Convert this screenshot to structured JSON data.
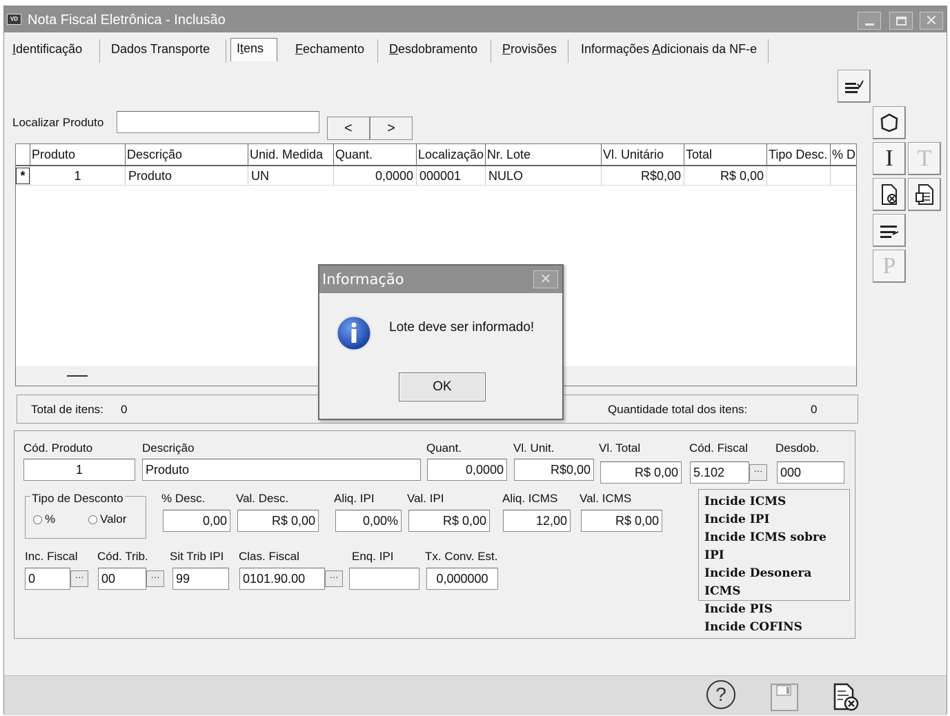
{
  "window": {
    "app_icon": "VD",
    "title": "Nota Fiscal Eletrônica - Inclusão"
  },
  "tabs": [
    {
      "pre": "",
      "u": "I",
      "post": "dentificação"
    },
    {
      "pre": "Dados Transporte",
      "u": "",
      "post": ""
    },
    {
      "pre": "I",
      "u": "t",
      "post": "ens"
    },
    {
      "pre": "",
      "u": "F",
      "post": "echamento"
    },
    {
      "pre": "",
      "u": "D",
      "post": "esdobramento"
    },
    {
      "pre": "",
      "u": "P",
      "post": "rovisões"
    },
    {
      "pre": "Informações ",
      "u": "A",
      "post": "dicionais da NF-e"
    }
  ],
  "search": {
    "label": "Localizar Produto",
    "value": "",
    "prev": "<",
    "next": ">"
  },
  "side_tools": {
    "i": "I",
    "t": "T",
    "p": "P"
  },
  "grid": {
    "headers": [
      "Produto",
      "Descrição",
      "Unid. Medida",
      "Quant.",
      "Localização",
      "Nr. Lote",
      "Vl. Unitário",
      "Total",
      "Tipo Desc.",
      "% D"
    ],
    "row": {
      "marker": "*",
      "cells": [
        "1",
        "Produto",
        "UN",
        "0,0000",
        "000001",
        "NULO",
        "R$0,00",
        "R$ 0,00",
        "",
        ""
      ]
    }
  },
  "totals": {
    "items_label": "Total de itens:",
    "items_value": "0",
    "qty_label": "Quantidade total dos itens:",
    "qty_value": "0"
  },
  "detail": {
    "cod_produto": {
      "label": "Cód. Produto",
      "value": "1"
    },
    "descricao": {
      "label": "Descrição",
      "value": "Produto"
    },
    "quant": {
      "label": "Quant.",
      "value": "0,0000"
    },
    "vl_unit": {
      "label": "Vl. Unit.",
      "value": "R$0,00"
    },
    "vl_total": {
      "label": "Vl. Total",
      "value": "R$ 0,00"
    },
    "cod_fiscal": {
      "label": "Cód. Fiscal",
      "value": "5.102"
    },
    "desdob": {
      "label": "Desdob.",
      "value": "000"
    },
    "tipo_desconto": {
      "label": "Tipo de Desconto",
      "opt_percent": "%",
      "opt_valor": "Valor"
    },
    "pct_desc": {
      "label": "% Desc.",
      "value": "0,00"
    },
    "val_desc": {
      "label": "Val. Desc.",
      "value": "R$ 0,00"
    },
    "aliq_ipi": {
      "label": "Aliq. IPI",
      "value": "0,00%"
    },
    "val_ipi": {
      "label": "Val. IPI",
      "value": "R$ 0,00"
    },
    "aliq_icms": {
      "label": "Aliq. ICMS",
      "value": "12,00"
    },
    "val_icms": {
      "label": "Val. ICMS",
      "value": "R$ 0,00"
    },
    "inc_fiscal": {
      "label": "Inc. Fiscal",
      "value": "0"
    },
    "cod_trib": {
      "label": "Cód. Trib.",
      "value": "00"
    },
    "sit_trib_ipi": {
      "label": "Sit Trib IPI",
      "value": "99"
    },
    "clas_fiscal": {
      "label": "Clas. Fiscal",
      "value": "0101.90.00"
    },
    "enq_ipi": {
      "label": "Enq. IPI",
      "value": ""
    },
    "tx_conv": {
      "label": "Tx. Conv. Est.",
      "value": "0,000000"
    },
    "incide": [
      "Incide ICMS",
      "Incide IPI",
      "Incide ICMS sobre IPI",
      "Incide Desonera ICMS",
      "Incide PIS",
      "Incide COFINS"
    ]
  },
  "dialog": {
    "title": "Informação",
    "message": "Lote deve ser informado!",
    "ok": "OK",
    "icon": "info-icon"
  },
  "bottom": {
    "help": "?"
  },
  "colors": {
    "titlebar": "#8f8f8f",
    "window_bg": "#f0f0f0",
    "info_blue": "#1f4fbf"
  }
}
